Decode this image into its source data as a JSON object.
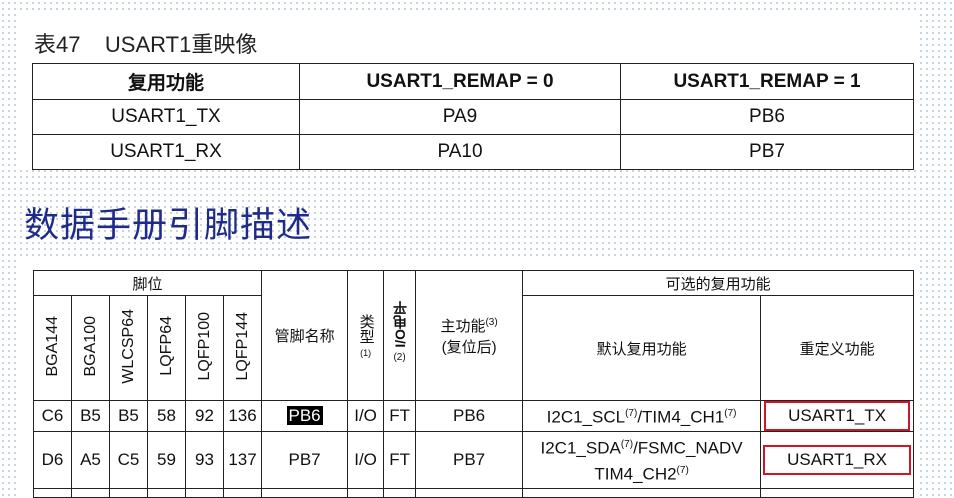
{
  "remap": {
    "caption": "表47    USART1重映像",
    "headers": [
      "复用功能",
      "USART1_REMAP = 0",
      "USART1_REMAP = 1"
    ],
    "rows": [
      [
        "USART1_TX",
        "PA9",
        "PB6"
      ],
      [
        "USART1_RX",
        "PA10",
        "PB7"
      ]
    ]
  },
  "section_title": "数据手册引脚描述",
  "pins": {
    "group_pins": "脚位",
    "group_alt": "可选的复用功能",
    "pkg_headers": [
      "BGA144",
      "BGA100",
      "WLCSP64",
      "LQFP64",
      "LQFP100",
      "LQFP144"
    ],
    "pin_name_header": "管脚名称",
    "type_header": "类型",
    "type_note": "(1)",
    "io_header": "I/O电平",
    "io_note": "(2)",
    "main_func_header_line1": "主功能",
    "main_func_note": "(3)",
    "main_func_header_line2": "(复位后)",
    "default_alt_header": "默认复用功能",
    "remap_header": "重定义功能",
    "rows": [
      {
        "pkg": [
          "C6",
          "B5",
          "B5",
          "58",
          "92",
          "136"
        ],
        "name": "PB6",
        "type": "I/O",
        "io": "FT",
        "main": "PB6",
        "default_alt_a": "I2C1_SCL",
        "note_a": "(7)",
        "default_alt_b": "/TIM4_CH1",
        "note_b": "(7)",
        "remap": "USART1_TX"
      },
      {
        "pkg": [
          "D6",
          "A5",
          "C5",
          "59",
          "93",
          "137"
        ],
        "name": "PB7",
        "type": "I/O",
        "io": "FT",
        "main": "PB7",
        "default_alt_a": "I2C1_SDA",
        "note_a": "(7)",
        "default_alt_b": "/FSMC_NADV",
        "default_alt_c": "TIM4_CH2",
        "note_c": "(7)",
        "remap": "USART1_RX"
      }
    ]
  },
  "colors": {
    "title": "#1f2b8a",
    "highlight_box": "#d0152a"
  }
}
